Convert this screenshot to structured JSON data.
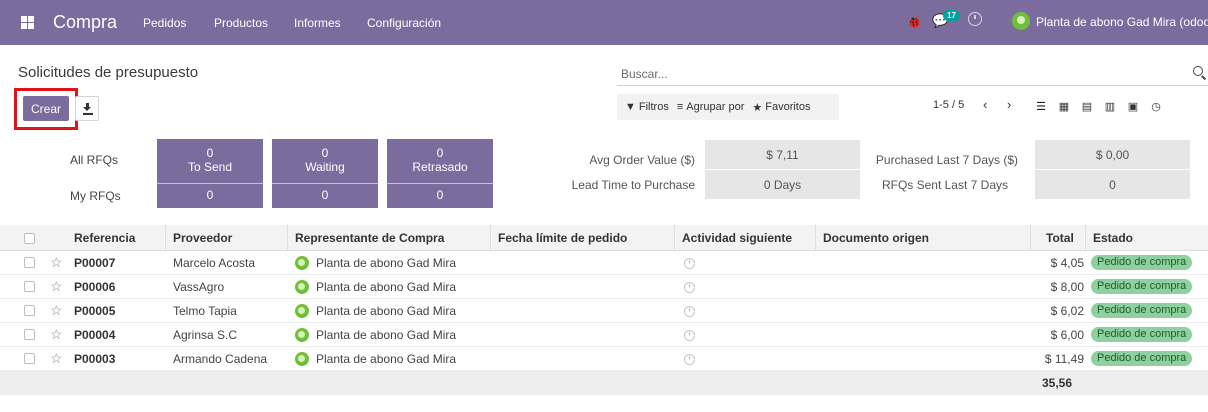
{
  "navbar": {
    "app_name": "Compra",
    "menu": [
      "Pedidos",
      "Productos",
      "Informes",
      "Configuración"
    ],
    "chat_count": "17",
    "user": "Planta de abono Gad Mira (odoo)",
    "bg_color": "#7c6b9d"
  },
  "page": {
    "title": "Solicitudes de presupuesto",
    "search_placeholder": "Buscar...",
    "create_label": "Crear",
    "filters_label": "Filtros",
    "group_label": "Agrupar por",
    "favorites_label": "Favoritos",
    "pager": "1-5 / 5"
  },
  "dashboard": {
    "row_labels": [
      "All RFQs",
      "My RFQs"
    ],
    "tiles": [
      {
        "top_value": "0",
        "label": "To Send",
        "bottom_value": "0"
      },
      {
        "top_value": "0",
        "label": "Waiting",
        "bottom_value": "0"
      },
      {
        "top_value": "0",
        "label": "Retrasado",
        "bottom_value": "0"
      }
    ],
    "kpis_left": [
      {
        "label": "Avg Order Value ($)",
        "value": "$ 7,11"
      },
      {
        "label": "Lead Time to Purchase",
        "value": "0  Days"
      }
    ],
    "kpis_right": [
      {
        "label": "Purchased Last 7 Days ($)",
        "value": "$ 0,00"
      },
      {
        "label": "RFQs Sent Last 7 Days",
        "value": "0"
      }
    ]
  },
  "table": {
    "headers": {
      "ref": "Referencia",
      "vendor": "Proveedor",
      "rep": "Representante de Compra",
      "deadline": "Fecha límite de pedido",
      "activity": "Actividad siguiente",
      "origin": "Documento origen",
      "total": "Total",
      "state": "Estado"
    },
    "rows": [
      {
        "ref": "P00007",
        "vendor": "Marcelo Acosta",
        "rep": "Planta de abono Gad Mira",
        "total": "$ 4,05",
        "state": "Pedido de compra"
      },
      {
        "ref": "P00006",
        "vendor": "VassAgro",
        "rep": "Planta de abono Gad Mira",
        "total": "$ 8,00",
        "state": "Pedido de compra"
      },
      {
        "ref": "P00005",
        "vendor": "Telmo Tapia",
        "rep": "Planta de abono Gad Mira",
        "total": "$ 6,02",
        "state": "Pedido de compra"
      },
      {
        "ref": "P00004",
        "vendor": "Agrinsa S.C",
        "rep": "Planta de abono Gad Mira",
        "total": "$ 6,00",
        "state": "Pedido de compra"
      },
      {
        "ref": "P00003",
        "vendor": "Armando Cadena",
        "rep": "Planta de abono Gad Mira",
        "total": "$ 11,49",
        "state": "Pedido de compra"
      }
    ],
    "grand_total": "35,56"
  }
}
